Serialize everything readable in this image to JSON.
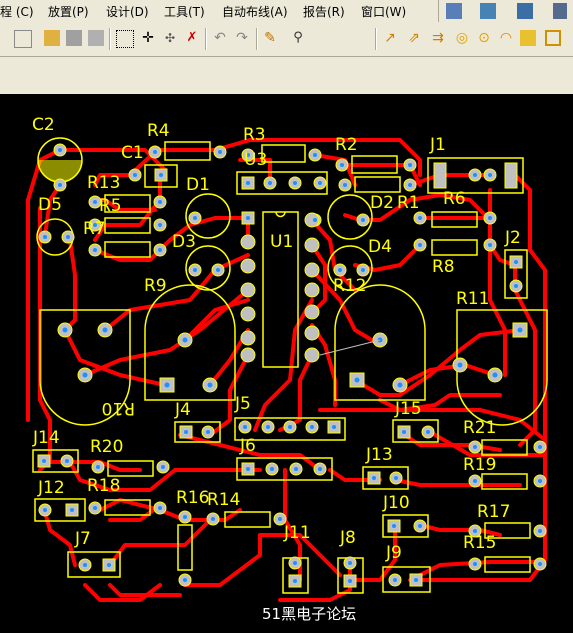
{
  "menu": {
    "items": [
      "程 (C)",
      "放置(P)",
      "设计(D)",
      "工具(T)",
      "自动布线(A)",
      "报告(R)",
      "窗口(W)"
    ]
  },
  "toolbar": {
    "icons": [
      "select-filter-icon",
      "layer-stack-icon",
      "align-icon",
      "new-icon",
      "open-icon",
      "save-icon",
      "copy-icon",
      "paste-icon",
      "select-icon",
      "move-icon",
      "cross-select-icon",
      "deselect-icon",
      "undo-icon",
      "redo-icon",
      "highlight-icon",
      "inspect-icon",
      "interactive-route-icon",
      "multi-route-icon",
      "diff-pair-icon",
      "pad-icon",
      "via-icon",
      "arc-icon",
      "fill-icon",
      "polygon-icon"
    ]
  },
  "board": {
    "watermark": "51黑电子论坛",
    "colors": {
      "track": "#ff0000",
      "silk": "#ffff00",
      "pad": "#c0c0c0",
      "hole": "#1e90ff"
    }
  },
  "labels": {
    "C2": "C2",
    "C1": "C1",
    "R4": "R4",
    "R3": "R3",
    "R2": "R2",
    "J1": "J1",
    "R13": "R13",
    "D1": "D1",
    "U3": "U3",
    "D2": "D2",
    "R1": "R1",
    "R6": "R6",
    "D5": "D5",
    "R5": "R5",
    "R7": "R7",
    "D3": "D3",
    "U1": "U1",
    "D4": "D4",
    "J2": "J2",
    "R8": "R8",
    "R9": "R9",
    "R12": "R12",
    "R11": "R11",
    "R10": "R10",
    "J4": "J4",
    "J5": "J5",
    "J15": "J15",
    "J14": "J14",
    "R20": "R20",
    "J6": "J6",
    "R21": "R21",
    "J13": "J13",
    "R19": "R19",
    "J12": "J12",
    "R18": "R18",
    "R16": "R16",
    "R14": "R14",
    "J10": "J10",
    "R17": "R17",
    "J7": "J7",
    "J11": "J11",
    "J8": "J8",
    "J9": "J9",
    "R15": "R15"
  }
}
